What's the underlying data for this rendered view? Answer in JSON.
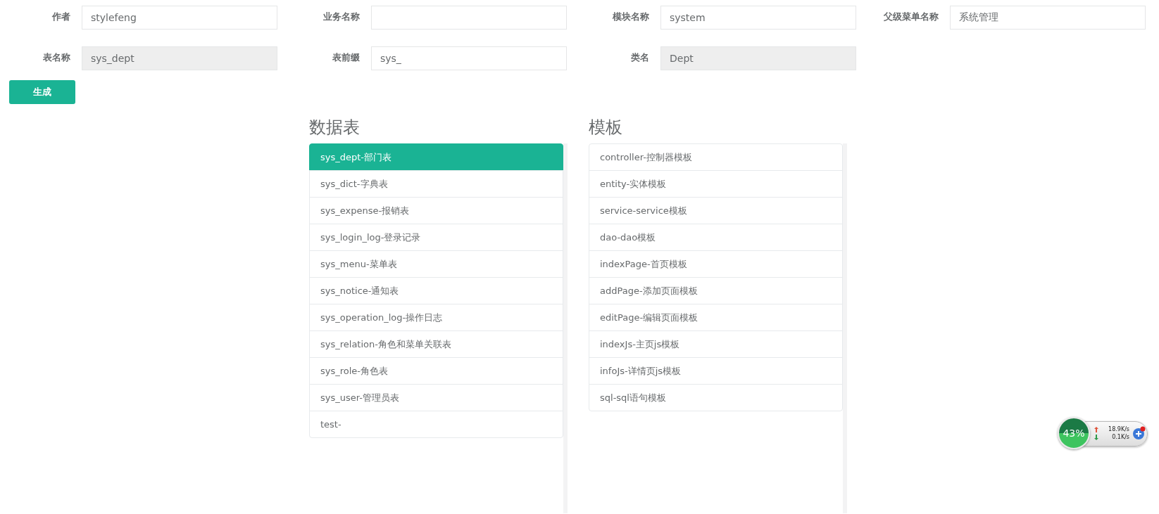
{
  "form": {
    "fields": [
      {
        "label": "作者",
        "value": "stylefeng",
        "disabled": false
      },
      {
        "label": "业务名称",
        "disabled": false
      },
      {
        "label": "模块名称",
        "value": "system",
        "disabled": false
      },
      {
        "label": "父级菜单名称",
        "value": "系统管理",
        "disabled": false
      },
      {
        "label": "表名称",
        "value": "sys_dept",
        "disabled": true
      },
      {
        "label": "表前缀",
        "value": "sys_",
        "disabled": false
      },
      {
        "label": "类名",
        "value": "Dept",
        "disabled": true
      }
    ],
    "submit": "生成"
  },
  "tables": {
    "title": "数据表",
    "items": [
      {
        "label": "sys_dept-部门表",
        "selected": true
      },
      {
        "label": "sys_dict-字典表",
        "selected": false
      },
      {
        "label": "sys_expense-报销表",
        "selected": false
      },
      {
        "label": "sys_login_log-登录记录",
        "selected": false
      },
      {
        "label": "sys_menu-菜单表",
        "selected": false
      },
      {
        "label": "sys_notice-通知表",
        "selected": false
      },
      {
        "label": "sys_operation_log-操作日志",
        "selected": false
      },
      {
        "label": "sys_relation-角色和菜单关联表",
        "selected": false
      },
      {
        "label": "sys_role-角色表",
        "selected": false
      },
      {
        "label": "sys_user-管理员表",
        "selected": false
      },
      {
        "label": "test-",
        "selected": false
      }
    ]
  },
  "templates": {
    "title": "模板",
    "items": [
      {
        "label": "controller-控制器模板",
        "selected": false
      },
      {
        "label": "entity-实体模板",
        "selected": false
      },
      {
        "label": "service-service模板",
        "selected": false
      },
      {
        "label": "dao-dao模板",
        "selected": false
      },
      {
        "label": "indexPage-首页模板",
        "selected": false
      },
      {
        "label": "addPage-添加页面模板",
        "selected": false
      },
      {
        "label": "editPage-编辑页面模板",
        "selected": false
      },
      {
        "label": "indexJs-主页js模板",
        "selected": false
      },
      {
        "label": "infoJs-详情页js模板",
        "selected": false
      },
      {
        "label": "sql-sql语句模板",
        "selected": false
      }
    ]
  },
  "speed_widget": {
    "percent": "43%",
    "upload": "18.9K/s",
    "download": "0.1K/s"
  }
}
